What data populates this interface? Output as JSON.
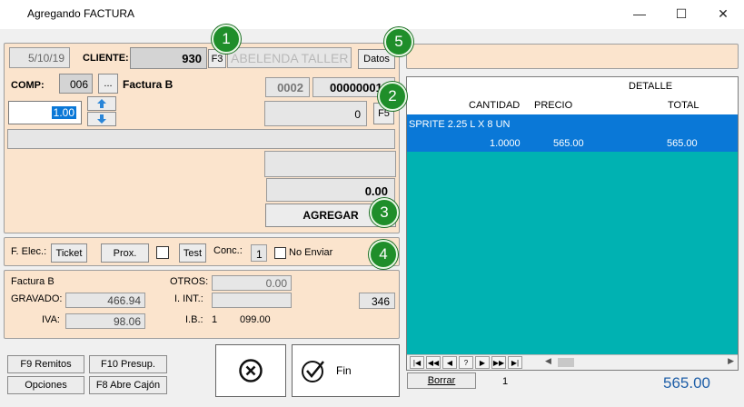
{
  "window": {
    "title": "Agregando FACTURA",
    "minimize_glyph": "—",
    "maximize_glyph": "☐",
    "close_glyph": "✕"
  },
  "header": {
    "date": "5/10/19",
    "cliente_label": "CLIENTE:",
    "cliente_code": "930",
    "f3_label": "F3",
    "cliente_name": "ABELENDA TALLER",
    "datos_label": "Datos"
  },
  "comp": {
    "label": "COMP:",
    "code": "006",
    "ellipsis_label": "...",
    "type": "Factura B",
    "punto_venta": "0002",
    "numero": "00000001"
  },
  "entry": {
    "quantity": "1.00",
    "price_value": "0",
    "f5_label": "F5",
    "amount": "0.00",
    "agregar_label": "AGREGAR"
  },
  "felec": {
    "label": "F. Elec.:",
    "ticket_label": "Ticket",
    "prox_label": "Prox.",
    "test_label": "Test",
    "conc_label": "Conc.:",
    "conc_value": "1",
    "no_enviar_label": "No Enviar"
  },
  "totals": {
    "doc_type": "Factura B",
    "gravado_label": "GRAVADO:",
    "gravado_value": "466.94",
    "iva_label": "IVA:",
    "iva_value": "98.06",
    "otros_label": "OTROS:",
    "otros_value": "0.00",
    "iint_label": "I. INT.:",
    "iint_value": "",
    "ib_label": "I.B.:",
    "ib_value": "1",
    "ib_amount": "099.00",
    "count_value": "346"
  },
  "buttons": {
    "remitos": "F9 Remitos",
    "presup": "F10 Presup.",
    "opciones": "Opciones",
    "abre_cajon": "F8 Abre Cajón",
    "fin": "Fin"
  },
  "grid": {
    "detalle_header": "DETALLE",
    "cantidad_header": "CANTIDAD",
    "precio_header": "PRECIO",
    "total_header": "TOTAL",
    "rows": [
      {
        "description": "SPRITE  2.25 L X 8 UN",
        "cantidad": "1.0000",
        "precio": "565.00",
        "total": "565.00"
      }
    ]
  },
  "footer": {
    "borrar_label": "Borrar",
    "item_count": "1",
    "grand_total": "565.00"
  },
  "badges": [
    "1",
    "2",
    "3",
    "4",
    "5"
  ],
  "colors": {
    "panel": "#fbe4cd",
    "grid": "#00b2b2",
    "selection": "#0a78d7",
    "badge": "#1f8e2a",
    "total": "#1f5fa8"
  }
}
